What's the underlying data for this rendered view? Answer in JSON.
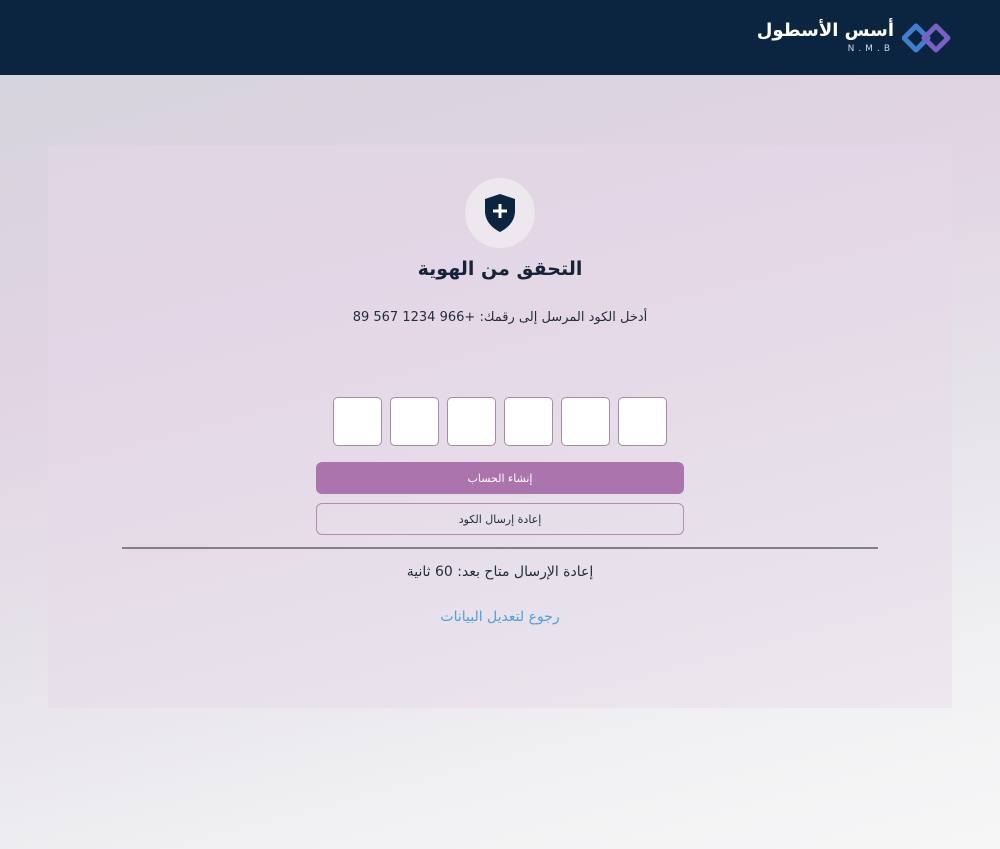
{
  "header": {
    "brand_name": "أسس الأسطول",
    "brand_sub": "N.M.B"
  },
  "verify": {
    "title": "التحقق من الهوية",
    "subtitle": "أدخل الكود المرسل إلى رقمك: +966 1234 567 89",
    "otp_digits": [
      "",
      "",
      "",
      "",
      "",
      ""
    ],
    "create_account_label": "إنشاء الحساب",
    "resend_label": "إعادة إرسال الكود",
    "timer_text": "إعادة الإرسال متاح بعد: 60 ثانية",
    "back_link": "رجوع لتعديل البيانات"
  },
  "colors": {
    "header_bg": "#0b2440",
    "primary": "#ab74ad",
    "link": "#4aa3d8",
    "logo_blue": "#3f7fd0",
    "logo_purple": "#7a5fc4"
  },
  "icons": {
    "logo": "brand-logo-mark",
    "shield": "shield-plus-icon"
  }
}
